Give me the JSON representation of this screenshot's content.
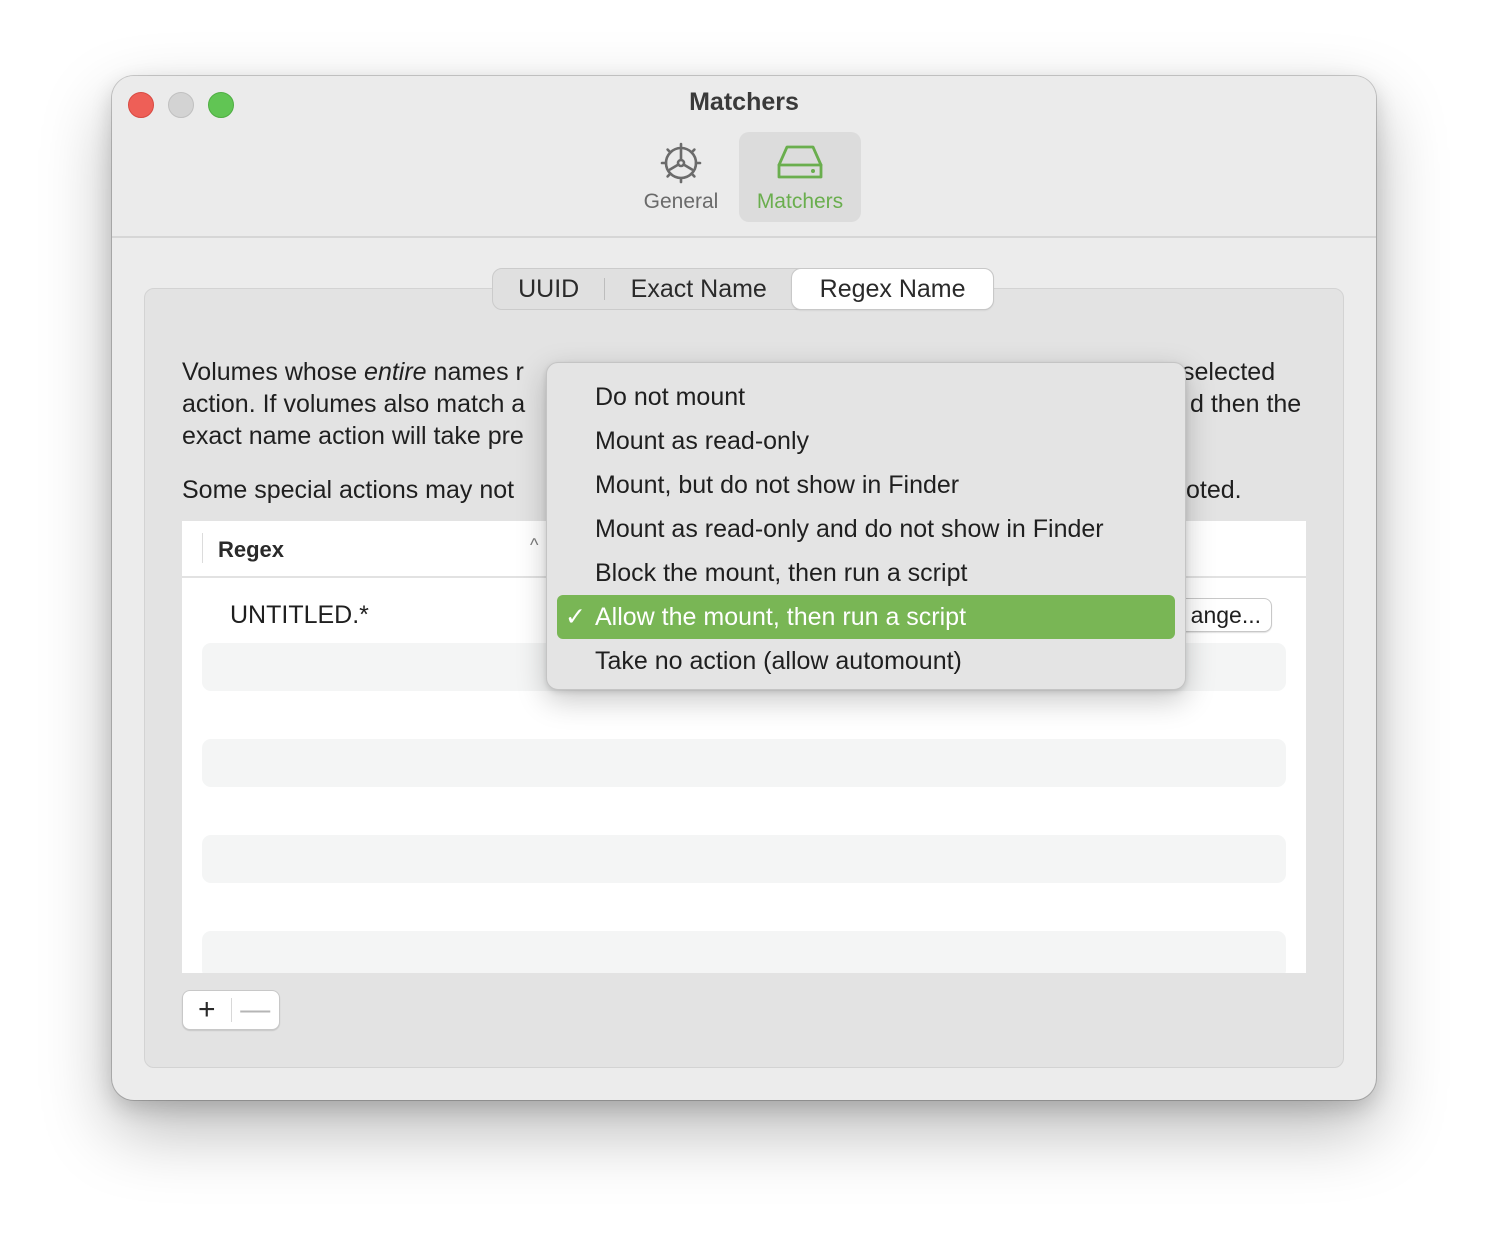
{
  "window": {
    "title": "Matchers"
  },
  "toolbar": {
    "items": [
      {
        "label": "General",
        "icon": "gear-icon",
        "selected": false
      },
      {
        "label": "Matchers",
        "icon": "drive-icon",
        "selected": true
      }
    ]
  },
  "colors": {
    "accent": "#79b655",
    "toolbar_selected_text": "#6aae4e"
  },
  "segments": {
    "items": [
      "UUID",
      "Exact Name",
      "Regex Name"
    ],
    "selected": "Regex Name"
  },
  "description": {
    "p1_start": "Volumes whose ",
    "p1_em": "entire",
    "p1_mid": " names r",
    "p1_right1": "selected",
    "p1_line2_left": "action. If volumes also match a",
    "p1_line2_right": "d then the",
    "p1_line3_left": "exact name action will take pre",
    "p2_left": "Some special actions may not",
    "p2_right": "oted."
  },
  "table": {
    "header_regex": "Regex",
    "sort_indicator": "^",
    "rows": [
      {
        "regex": "UNTITLED.*",
        "button": "ange..."
      }
    ]
  },
  "add_remove": {
    "add": "+",
    "remove": "—"
  },
  "menu": {
    "checkmark": "✓",
    "items": [
      "Do not mount",
      "Mount as read-only",
      "Mount, but do not show in Finder",
      "Mount as read-only and do not show in Finder",
      "Block the mount, then run a script",
      "Allow the mount, then run a script",
      "Take no action (allow automount)"
    ],
    "selected_index": 5
  }
}
